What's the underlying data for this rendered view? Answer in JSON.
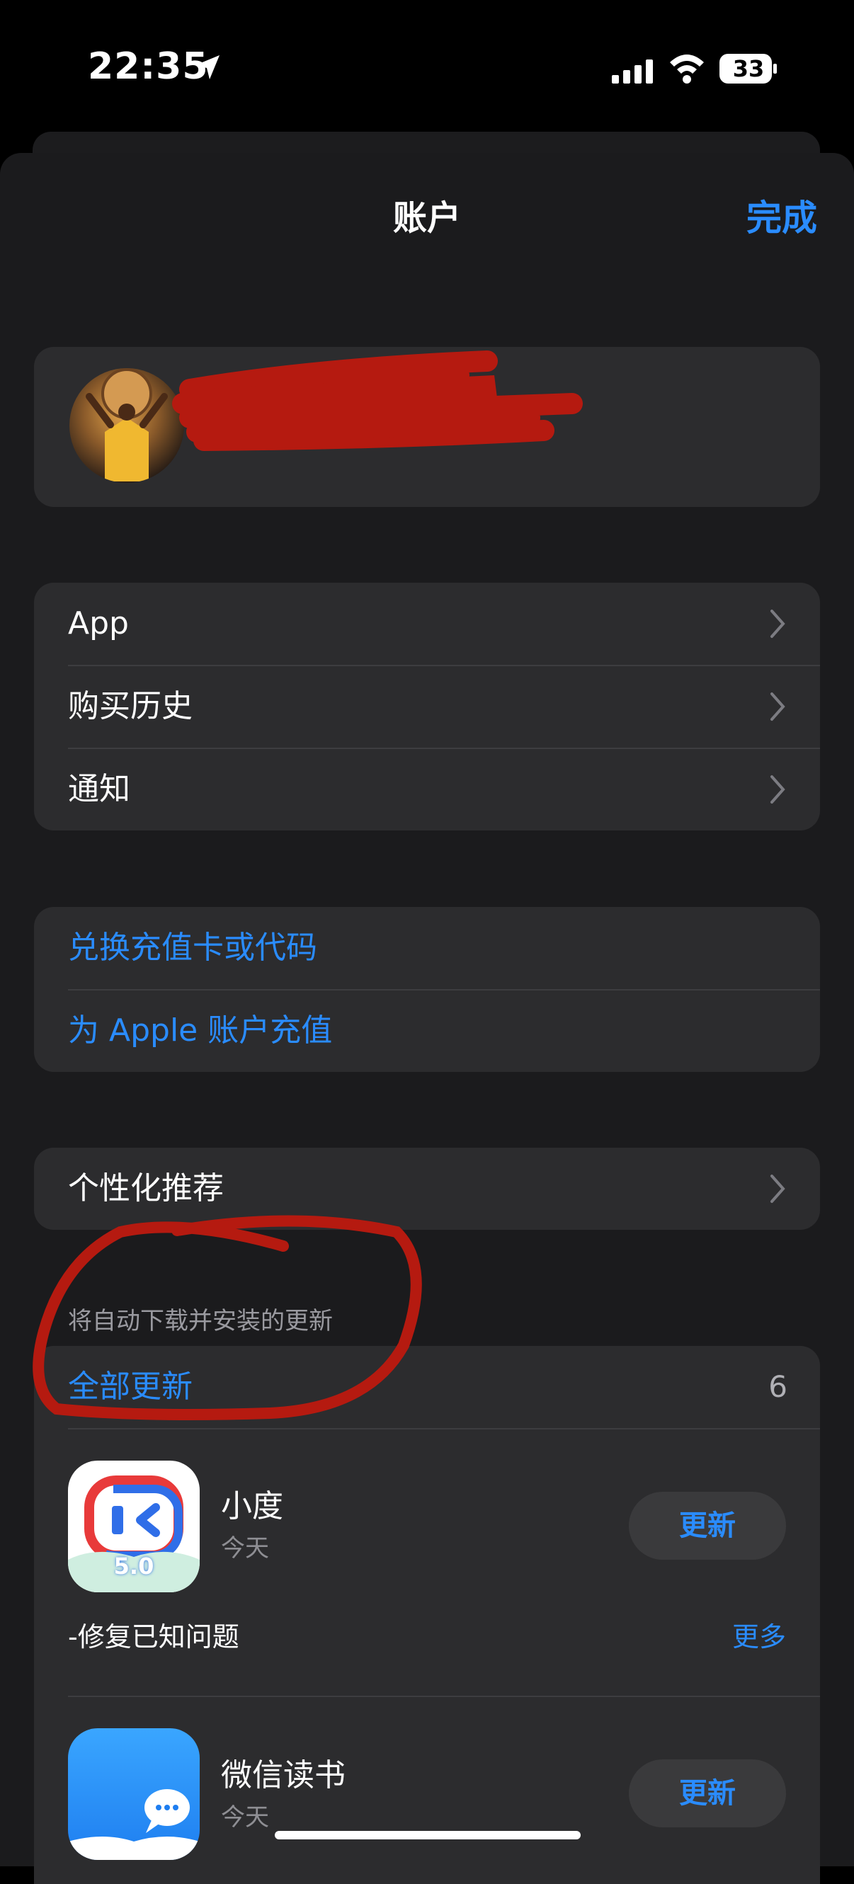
{
  "status_bar": {
    "time": "22:35",
    "battery": "33"
  },
  "nav": {
    "title": "账户",
    "done": "完成"
  },
  "menu": [
    {
      "label": "App"
    },
    {
      "label": "购买历史"
    },
    {
      "label": "通知"
    }
  ],
  "actions": [
    {
      "label": "兑换充值卡或代码"
    },
    {
      "label": "为 Apple 账户充值"
    }
  ],
  "personalized": {
    "label": "个性化推荐"
  },
  "updates": {
    "section_note": "将自动下载并安装的更新",
    "update_all": "全部更新",
    "count": "6",
    "apps": [
      {
        "name": "小度",
        "date": "今天",
        "button": "更新",
        "note": "-修复已知问题",
        "more": "更多",
        "badge": "5.0"
      },
      {
        "name": "微信读书",
        "date": "今天",
        "button": "更新"
      }
    ]
  },
  "colors": {
    "accent": "#2a8cff",
    "card": "#2c2c2e",
    "background": "#1b1b1d",
    "annotation": "#b51a10"
  }
}
